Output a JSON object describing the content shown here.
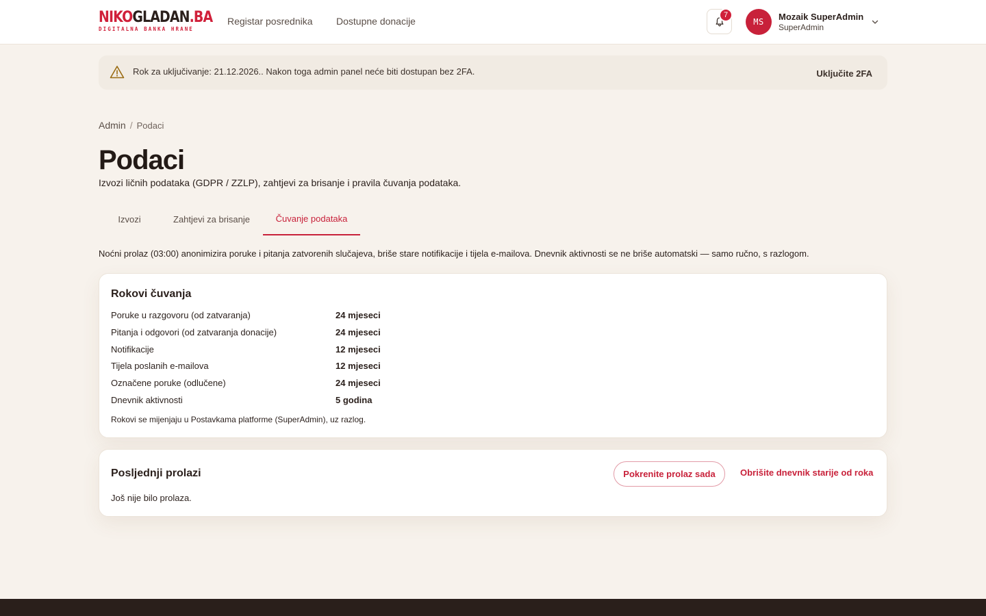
{
  "brand": {
    "logo_red": "NIKO",
    "logo_dark": "GLADAN",
    "logo_suffix": ".BA",
    "tagline": "DIGITALNA BANKA HRANE",
    "accent_color": "#d0203a"
  },
  "nav": {
    "items": [
      {
        "label": "Registar posrednika"
      },
      {
        "label": "Dostupne donacije"
      }
    ]
  },
  "notifications": {
    "count": "7",
    "icon": "bell-icon"
  },
  "user": {
    "initials": "MS",
    "name": "Mozaik SuperAdmin",
    "role": "SuperAdmin"
  },
  "alert": {
    "icon": "warning-triangle-icon",
    "text": "Rok za uključivanje: 21.12.2026.. Nakon toga admin panel neće biti dostupan bez 2FA.",
    "action_label": "Uključite 2FA"
  },
  "breadcrumb": {
    "root": "Admin",
    "separator": "/",
    "current": "Podaci"
  },
  "page": {
    "title": "Podaci",
    "subtitle": "Izvozi ličnih podataka (GDPR / ZZLP), zahtjevi za brisanje i pravila čuvanja podataka."
  },
  "tabs": {
    "items": [
      {
        "label": "Izvozi",
        "active": false
      },
      {
        "label": "Zahtjevi za brisanje",
        "active": false
      },
      {
        "label": "Čuvanje podataka",
        "active": true
      }
    ]
  },
  "intro": "Noćni prolaz (03:00) anonimizira poruke i pitanja zatvorenih slučajeva, briše stare notifikacije i tijela e-mailova. Dnevnik aktivnosti se ne briše automatski — samo ručno, s razlogom.",
  "retention": {
    "title": "Rokovi čuvanja",
    "rows": [
      {
        "label": "Poruke u razgovoru (od zatvaranja)",
        "value": "24 mjeseci"
      },
      {
        "label": "Pitanja i odgovori (od zatvaranja donacije)",
        "value": "24 mjeseci"
      },
      {
        "label": "Notifikacije",
        "value": "12 mjeseci"
      },
      {
        "label": "Tijela poslanih e-mailova",
        "value": "12 mjeseci"
      },
      {
        "label": "Označene poruke (odlučene)",
        "value": "24 mjeseci"
      },
      {
        "label": "Dnevnik aktivnosti",
        "value": "5 godina"
      }
    ],
    "note": "Rokovi se mijenjaju u Postavkama platforme (SuperAdmin), uz razlog."
  },
  "runs": {
    "title": "Posljednji prolazi",
    "run_button_label": "Pokrenite prolaz sada",
    "purge_link_label": "Obrišite dnevnik starije od roka",
    "empty_text": "Još nije bilo prolaza."
  }
}
